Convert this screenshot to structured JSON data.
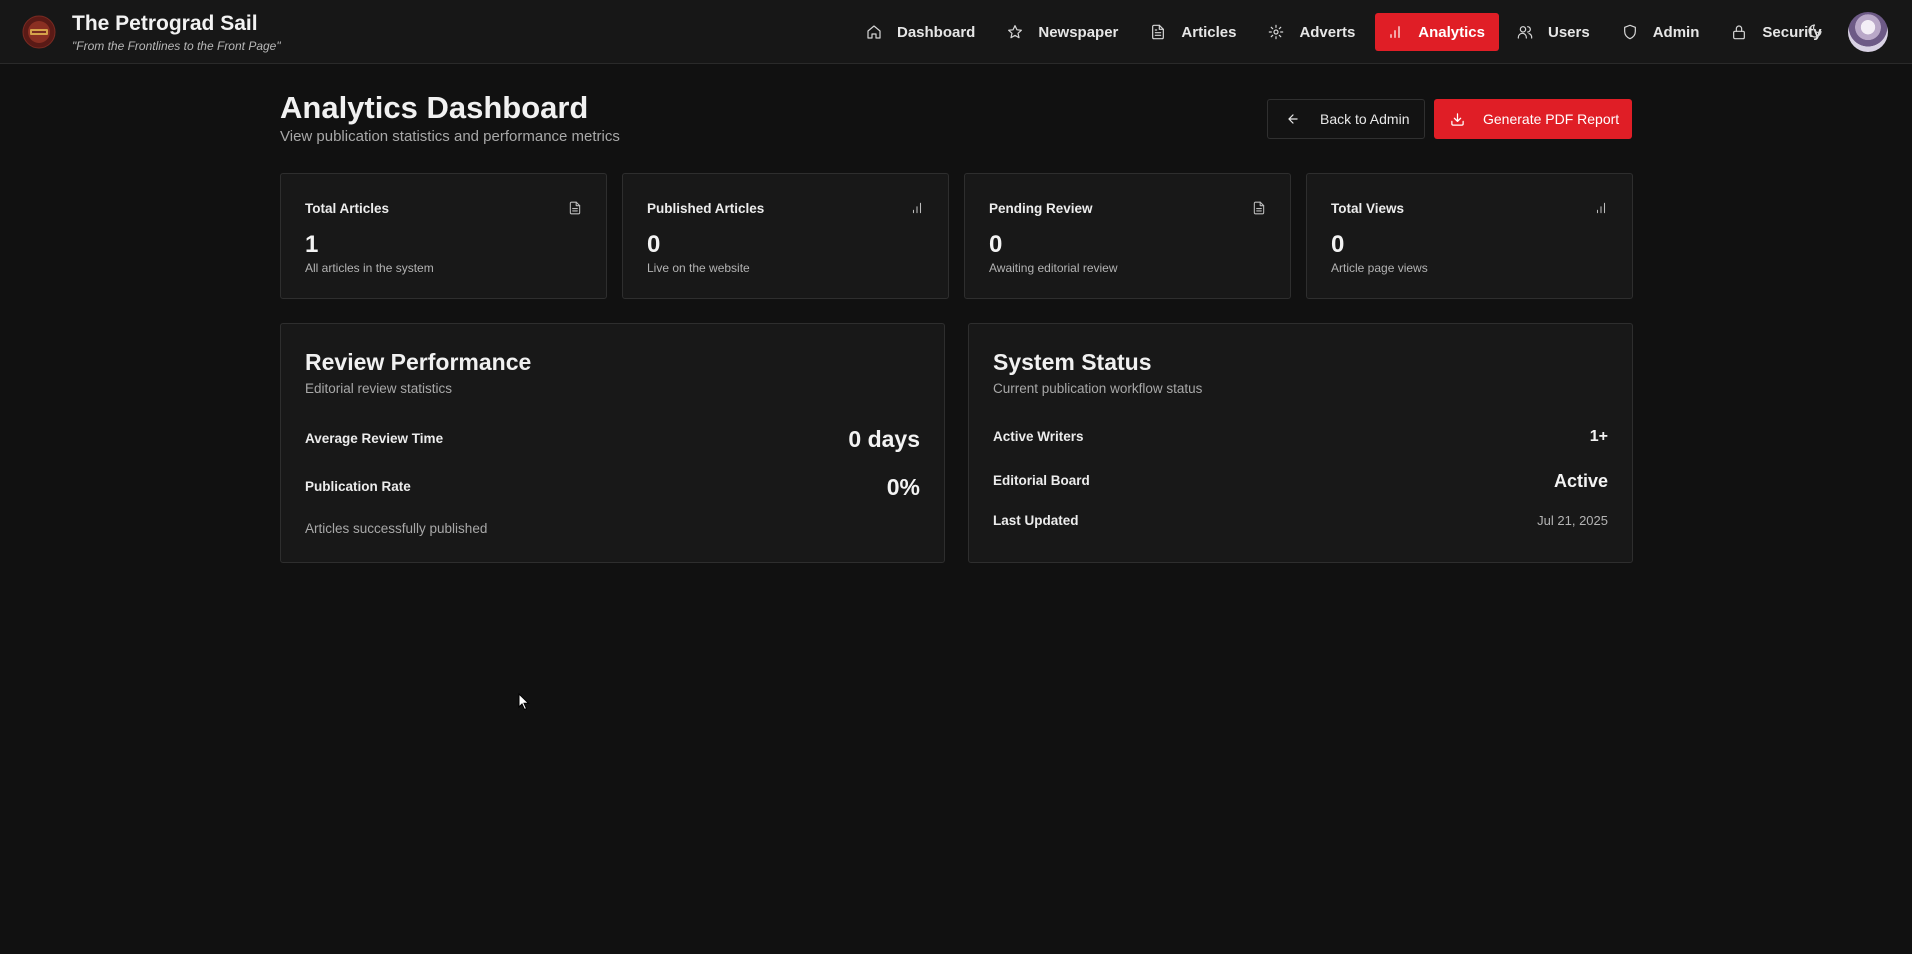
{
  "brand": {
    "name": "The Petrograd Sail",
    "tagline": "\"From the Frontlines to the Front Page\"",
    "accent_color": "#e01e26"
  },
  "nav": {
    "items": [
      {
        "label": "Dashboard",
        "icon": "home-icon",
        "active": false
      },
      {
        "label": "Newspaper",
        "icon": "star-icon",
        "active": false
      },
      {
        "label": "Articles",
        "icon": "document-icon",
        "active": false
      },
      {
        "label": "Adverts",
        "icon": "gear-icon",
        "active": false
      },
      {
        "label": "Analytics",
        "icon": "bar-chart-icon",
        "active": true
      },
      {
        "label": "Users",
        "icon": "users-icon",
        "active": false
      },
      {
        "label": "Admin",
        "icon": "shield-icon",
        "active": false
      },
      {
        "label": "Security",
        "icon": "lock-icon",
        "active": false
      }
    ],
    "theme_toggle_icon": "moon-icon"
  },
  "header": {
    "title": "Analytics Dashboard",
    "subtitle": "View publication statistics and performance metrics",
    "back_label": "Back to Admin",
    "pdf_label": "Generate PDF Report"
  },
  "stats": [
    {
      "title": "Total Articles",
      "value": "1",
      "desc": "All articles in the system",
      "icon": "document-icon"
    },
    {
      "title": "Published Articles",
      "value": "0",
      "desc": "Live on the website",
      "icon": "bar-chart-icon"
    },
    {
      "title": "Pending Review",
      "value": "0",
      "desc": "Awaiting editorial review",
      "icon": "document-icon"
    },
    {
      "title": "Total Views",
      "value": "0",
      "desc": "Article page views",
      "icon": "bar-chart-icon"
    }
  ],
  "review": {
    "title": "Review Performance",
    "subtitle": "Editorial review statistics",
    "avg_label": "Average Review Time",
    "avg_value": "0 days",
    "rate_label": "Publication Rate",
    "rate_value": "0%",
    "note": "Articles successfully published"
  },
  "system": {
    "title": "System Status",
    "subtitle": "Current publication workflow status",
    "writers_label": "Active Writers",
    "writers_value": "1+",
    "board_label": "Editorial Board",
    "board_value": "Active",
    "updated_label": "Last Updated",
    "updated_value": "Jul 21, 2025"
  }
}
